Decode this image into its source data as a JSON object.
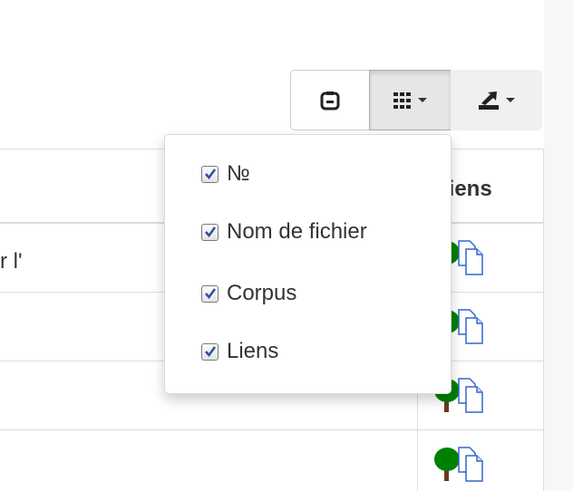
{
  "toolbar": {
    "buttons": [
      {
        "name": "refresh",
        "icon": "refresh-icon"
      },
      {
        "name": "columns",
        "icon": "columns-grid-icon",
        "caret": true,
        "active": true
      },
      {
        "name": "export",
        "icon": "export-icon",
        "caret": true
      }
    ]
  },
  "table": {
    "header": {
      "liens": "Liens"
    },
    "rows": [
      {
        "text": "r l'",
        "icons": [
          "tree-icon",
          "document-icon"
        ]
      },
      {
        "text": "",
        "icons": [
          "tree-icon",
          "document-icon"
        ]
      },
      {
        "text": "",
        "icons": [
          "tree-icon",
          "document-icon"
        ]
      },
      {
        "text": "",
        "icons": [
          "tree-icon",
          "document-icon"
        ]
      }
    ]
  },
  "columns_menu": {
    "items": [
      {
        "label": "№",
        "checked": true
      },
      {
        "label": "Nom de fichier",
        "checked": true
      },
      {
        "label": "Corpus",
        "checked": true
      },
      {
        "label": "Liens",
        "checked": true
      }
    ]
  },
  "colors": {
    "border": "#dddddd",
    "text": "#333333",
    "tree_green": "#008000",
    "tree_trunk": "#6b3a1f",
    "doc_blue": "#3366cc",
    "checkbox_mark": "#2a4ea8"
  }
}
